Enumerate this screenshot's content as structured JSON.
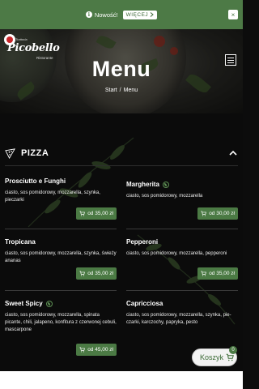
{
  "notice": {
    "text": "Nowość!",
    "button": "WIĘCEJ",
    "close": "×"
  },
  "logo": {
    "name": "Picobello",
    "sub_top": "Trattoria",
    "sub_bottom": "Ristorante"
  },
  "hero": {
    "title": "Menu",
    "breadcrumb": [
      "Start",
      "/",
      "Menu"
    ]
  },
  "category": {
    "title": "PIZZA"
  },
  "items": [
    {
      "name": "Prosciutto e Funghi",
      "desc": "ciasto, sos pomidorowy, mozzarella, szynka, pieczarki",
      "price": "od 35,00 zł",
      "badge": false
    },
    {
      "name": "Margherita",
      "desc": "ciasto, sos pomidorowy, mozzarella",
      "price": "od 30,00 zł",
      "badge": true
    },
    {
      "name": "Tropicana",
      "desc": "ciasto, sos pomidorowy, mozzarella, szynka, świeży ananas",
      "price": "od 35,00 zł",
      "badge": false
    },
    {
      "name": "Pepperoni",
      "desc": "ciasto, sos pomidorowy, mozzarella, pepperoni",
      "price": "od 35,00 zł",
      "badge": false
    },
    {
      "name": "Sweet Spicy",
      "desc": "ciasto, sos pomidorowy, mozzarella, spinata picante, chili, jalapeno, konfitura z czerwonej cebuli, mascarpone",
      "price": "od 45,00 zł",
      "badge": true
    },
    {
      "name": "Capricciosa",
      "desc": "ciasto, sos pomidorowy, mozzarella, szynka, pie-czarki, karczochy, papryka, pesto",
      "price": null,
      "badge": false
    }
  ],
  "cart": {
    "label": "Koszyk",
    "count": "0"
  },
  "colors": {
    "accent": "#4b7a44",
    "notice_bg": "#4d7a46",
    "background": "#0b0b0b"
  },
  "icons": [
    "info-icon",
    "chevron-right-icon",
    "close-icon",
    "hamburger-icon",
    "pizza-slice-icon",
    "chevron-up-icon",
    "cart-icon",
    "leaf-icon"
  ]
}
